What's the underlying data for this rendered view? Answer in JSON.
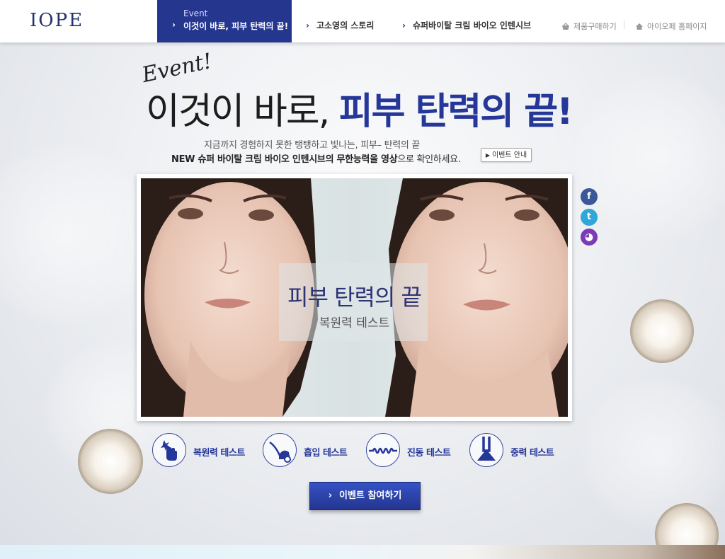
{
  "header": {
    "logo": "IOPE",
    "nav_active": {
      "small": "Event",
      "label": "이것이 바로, 피부 탄력의 끝!"
    },
    "nav": [
      "고소영의 스토리",
      "슈퍼바이탈 크림 바이오 인텐시브"
    ],
    "util": [
      "제품구매하기",
      "아이오페 홈페이지"
    ]
  },
  "hero": {
    "script": "Event!",
    "headline_dark": "이것이 바로,",
    "headline_blue": "피부 탄력의 끝!",
    "sub1": "지금까지 경험하지 못한 탱탱하고 빛나는, 피부– 탄력의 끝",
    "sub2_bold1": "NEW 슈퍼 바이탈 크림 바이오 인텐시브의 무한능력을 영상",
    "sub2_rest": "으로 확인하세요.",
    "info_button": "이벤트 안내"
  },
  "video": {
    "title": "피부 탄력의 끝",
    "subtitle": "복원력 테스트"
  },
  "social": [
    {
      "name": "facebook",
      "glyph": "f",
      "color": "#3b5998"
    },
    {
      "name": "twitter",
      "glyph": "t",
      "color": "#2fa7d9"
    },
    {
      "name": "me2day",
      "glyph": "◕",
      "color": "#7a3bb5"
    }
  ],
  "tests": [
    {
      "label": "복원력 테스트",
      "icon": "hand-press-icon"
    },
    {
      "label": "흡입 테스트",
      "icon": "vacuum-icon"
    },
    {
      "label": "진동 테스트",
      "icon": "wave-icon"
    },
    {
      "label": "중력 테스트",
      "icon": "gravity-icon"
    }
  ],
  "cta": {
    "label": "이벤트 참여하기"
  },
  "colors": {
    "brand": "#25368f",
    "accent_text": "#26379a"
  }
}
